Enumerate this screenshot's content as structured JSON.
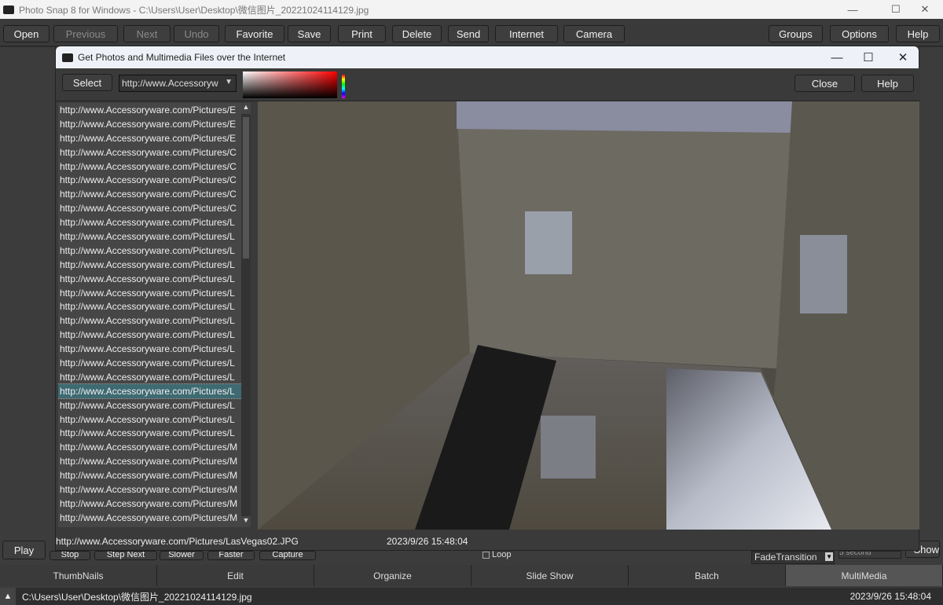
{
  "app": {
    "title": "Photo Snap 8 for Windows - C:\\Users\\User\\Desktop\\微信图片_20221024114129.jpg"
  },
  "toolbar": {
    "open": "Open",
    "previous": "Previous",
    "next": "Next",
    "undo": "Undo",
    "favorite": "Favorite",
    "save": "Save",
    "print": "Print",
    "delete": "Delete",
    "send": "Send",
    "internet": "Internet",
    "camera": "Camera",
    "groups": "Groups",
    "options": "Options",
    "help": "Help"
  },
  "dialog": {
    "title": "Get Photos and Multimedia Files over the Internet",
    "select": "Select",
    "url_value": "http://www.Accessoryw",
    "close": "Close",
    "help": "Help",
    "items": [
      "http://www.Accessoryware.com/Pictures/E",
      "http://www.Accessoryware.com/Pictures/E",
      "http://www.Accessoryware.com/Pictures/E",
      "http://www.Accessoryware.com/Pictures/C",
      "http://www.Accessoryware.com/Pictures/C",
      "http://www.Accessoryware.com/Pictures/C",
      "http://www.Accessoryware.com/Pictures/C",
      "http://www.Accessoryware.com/Pictures/C",
      "http://www.Accessoryware.com/Pictures/L",
      "http://www.Accessoryware.com/Pictures/L",
      "http://www.Accessoryware.com/Pictures/L",
      "http://www.Accessoryware.com/Pictures/L",
      "http://www.Accessoryware.com/Pictures/L",
      "http://www.Accessoryware.com/Pictures/L",
      "http://www.Accessoryware.com/Pictures/L",
      "http://www.Accessoryware.com/Pictures/L",
      "http://www.Accessoryware.com/Pictures/L",
      "http://www.Accessoryware.com/Pictures/L",
      "http://www.Accessoryware.com/Pictures/L",
      "http://www.Accessoryware.com/Pictures/L",
      "http://www.Accessoryware.com/Pictures/L",
      "http://www.Accessoryware.com/Pictures/L",
      "http://www.Accessoryware.com/Pictures/L",
      "http://www.Accessoryware.com/Pictures/L",
      "http://www.Accessoryware.com/Pictures/M",
      "http://www.Accessoryware.com/Pictures/M",
      "http://www.Accessoryware.com/Pictures/M",
      "http://www.Accessoryware.com/Pictures/M",
      "http://www.Accessoryware.com/Pictures/M",
      "http://www.Accessoryware.com/Pictures/M"
    ],
    "selected_index": 20,
    "status_url": "http://www.Accessoryware.com/Pictures/LasVegas02.JPG",
    "status_time": "2023/9/26 15:48:04"
  },
  "media": {
    "play": "Play",
    "stop": "Stop",
    "step_next": "Step Next",
    "slower": "Slower",
    "faster": "Faster",
    "capture": "Capture",
    "loop": "Loop",
    "transition": "FadeTransition",
    "duration": "5 second",
    "show": "Show"
  },
  "tabs": [
    "ThumbNails",
    "Edit",
    "Organize",
    "Slide Show",
    "Batch",
    "MultiMedia"
  ],
  "active_tab": "MultiMedia",
  "statusbar": {
    "path": "C:\\Users\\User\\Desktop\\微信图片_20221024114129.jpg",
    "time": "2023/9/26 15:48:04"
  }
}
